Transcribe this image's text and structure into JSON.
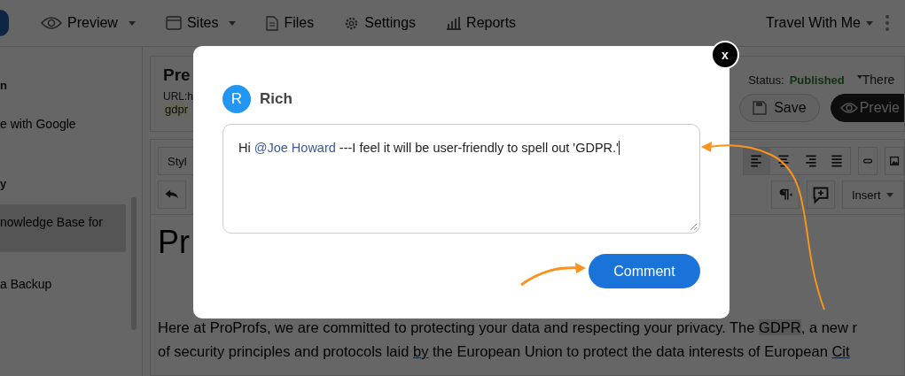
{
  "nav": {
    "items": [
      {
        "label": "Preview",
        "has_menu": true
      },
      {
        "label": "Sites",
        "has_menu": true
      },
      {
        "label": "Files",
        "has_menu": false
      },
      {
        "label": "Settings",
        "has_menu": false
      },
      {
        "label": "Reports",
        "has_menu": false
      }
    ],
    "site_menu": {
      "label": "Travel With Me",
      "has_menu": true
    }
  },
  "sidebar": {
    "groups": [
      {
        "title": "n",
        "items": [
          {
            "label": "e with Google",
            "selected": false
          }
        ]
      },
      {
        "title": "y",
        "items": [
          {
            "label": "nowledge Base for",
            "selected": true
          },
          {
            "label": "a Backup",
            "selected": false
          }
        ]
      }
    ]
  },
  "editor": {
    "title": "Pre",
    "url": "URL:h",
    "tag": "gdpr",
    "status_label": "Status:",
    "status": "Published",
    "visibility": "There",
    "buttons": [
      {
        "label": "Save",
        "kind": "outline"
      },
      {
        "label": "Previe",
        "kind": "dark"
      }
    ],
    "style_menu": "Styl",
    "insert_menu": "Insert",
    "heading": "Pr",
    "lines": [
      {
        "parts": [
          {
            "text": "Here at ProProfs, we are committed to protecting your data and respecting your privacy. The ",
            "kind": "plain"
          },
          {
            "text": "GDPR",
            "kind": "highlight"
          },
          {
            "text": ", a new r",
            "kind": "plain"
          }
        ]
      },
      {
        "parts": [
          {
            "text": "of security principles and protocols laid ",
            "kind": "plain"
          },
          {
            "text": "by",
            "kind": "underline"
          },
          {
            "text": " the European Union to protect the data interests of European ",
            "kind": "plain"
          },
          {
            "text": "Cit",
            "kind": "underline"
          }
        ]
      }
    ]
  },
  "dialog": {
    "close": "x",
    "avatar": "R",
    "author": "Rich",
    "comment": [
      {
        "text": "Hi ",
        "kind": "plain"
      },
      {
        "text": "@Joe Howard",
        "kind": "mention"
      },
      {
        "text": " ---I feel it will be user-friendly to spell out 'GDPR.'",
        "kind": "plain"
      }
    ],
    "submit": "Comment"
  }
}
